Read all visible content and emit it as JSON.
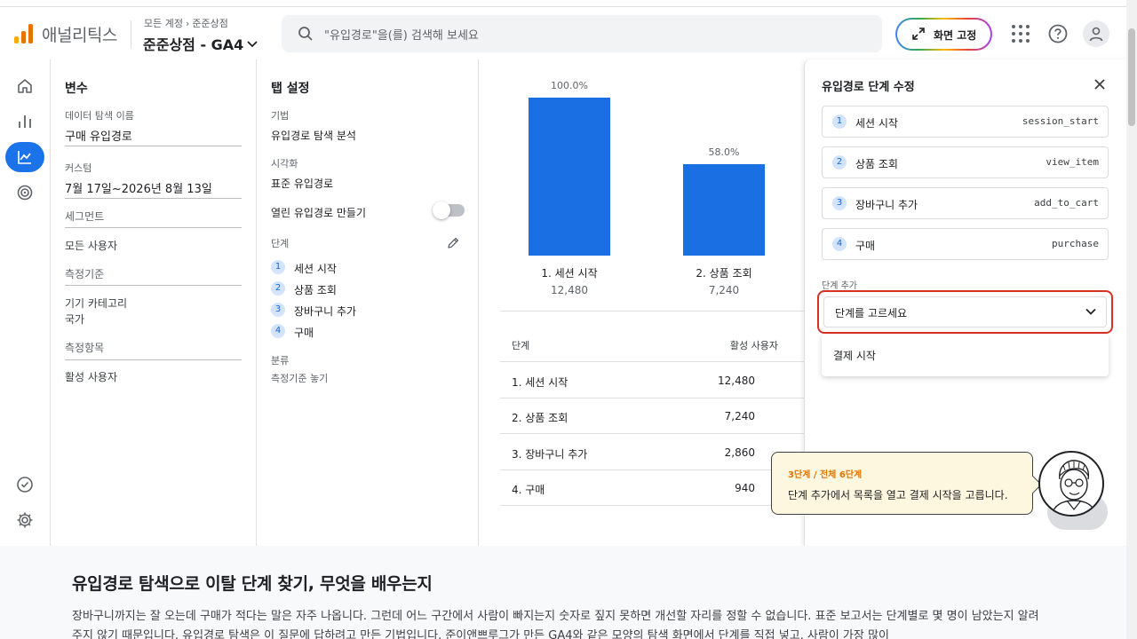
{
  "header": {
    "brand": "애널리틱스",
    "breadcrumb": [
      "모든 계정",
      "준준상점"
    ],
    "property": "준준상점 - GA4",
    "search_placeholder": "\"유입경로\"을(를) 검색해 보세요",
    "pin_button": "화면 고정"
  },
  "variables": {
    "title": "변수",
    "exploration_name_label": "데이터 탐색 이름",
    "exploration_name": "구매 유입경로",
    "custom_label": "커스텀",
    "date_range": "7월 17일~2026년 8월 13일",
    "segments_label": "세그먼트",
    "segment": "모든 사용자",
    "dimensions_label": "측정기준",
    "dimension_name": "기기 카테고리",
    "dimension_value": "국가",
    "metrics_label": "측정항목",
    "metric": "활성 사용자"
  },
  "tab_settings": {
    "title": "탭 설정",
    "technique_label": "기법",
    "technique": "유입경로 탐색 분석",
    "viz_label": "시각화",
    "viz": "표준 유입경로",
    "open_funnel": "열린 유입경로 만들기",
    "steps_label": "단계",
    "steps": [
      "세션 시작",
      "상품 조회",
      "장바구니 추가",
      "구매"
    ],
    "breakdown_label": "분류",
    "breakdown": "측정기준 놓기"
  },
  "chart_data": {
    "type": "bar",
    "categories": [
      "1. 세션 시작",
      "2. 상품 조회"
    ],
    "values": [
      100.0,
      58.0
    ],
    "data_labels": [
      "100.0%",
      "58.0%"
    ],
    "counts": [
      "12,480",
      "7,240"
    ],
    "ylim": [
      0,
      100
    ]
  },
  "table": {
    "headers": [
      "단계",
      "활성 사용자"
    ],
    "rows": [
      [
        "1. 세션 시작",
        "12,480"
      ],
      [
        "2. 상품 조회",
        "7,240"
      ],
      [
        "3. 장바구니 추가",
        "2,860"
      ],
      [
        "4. 구매",
        "940"
      ]
    ]
  },
  "panel": {
    "title": "유입경로 단계 수정",
    "steps": [
      {
        "num": "1",
        "name": "세션 시작",
        "event": "session_start"
      },
      {
        "num": "2",
        "name": "상품 조회",
        "event": "view_item"
      },
      {
        "num": "3",
        "name": "장바구니 추가",
        "event": "add_to_cart"
      },
      {
        "num": "4",
        "name": "구매",
        "event": "purchase"
      }
    ],
    "add_step_label": "단계 추가",
    "select_placeholder": "단계를 고르세요",
    "dropdown_option": "결제 시작"
  },
  "tooltip": {
    "progress": "3단계 / 전체 6단계",
    "message": "단계 추가에서 목록을 열고 결제 시작을 고릅니다."
  },
  "article": {
    "title": "유입경로 탐색으로 이탈 단계 찾기, 무엇을 배우는지",
    "body": "장바구니까지는 잘 오는데 구매가 적다는 말은 자주 나옵니다. 그런데 어느 구간에서 사람이 빠지는지 숫자로 짚지 못하면 개선할 자리를 정할 수 없습니다. 표준 보고서는 단계별로 몇 명이 남았는지 알려 주지 않기 때문입니다. 유입경로 탐색은 이 질문에 답하려고 만든 기법입니다. 준이앤쁘루그가 만든 GA4와 같은 모양의 탐색 화면에서 단계를 직접 넣고, 사람이 가장 많이"
  },
  "colors": {
    "accent": "#1a73e8",
    "bar": "#1a6fe3",
    "highlight": "#d93025",
    "tooltip_bg": "#fef7e0"
  }
}
